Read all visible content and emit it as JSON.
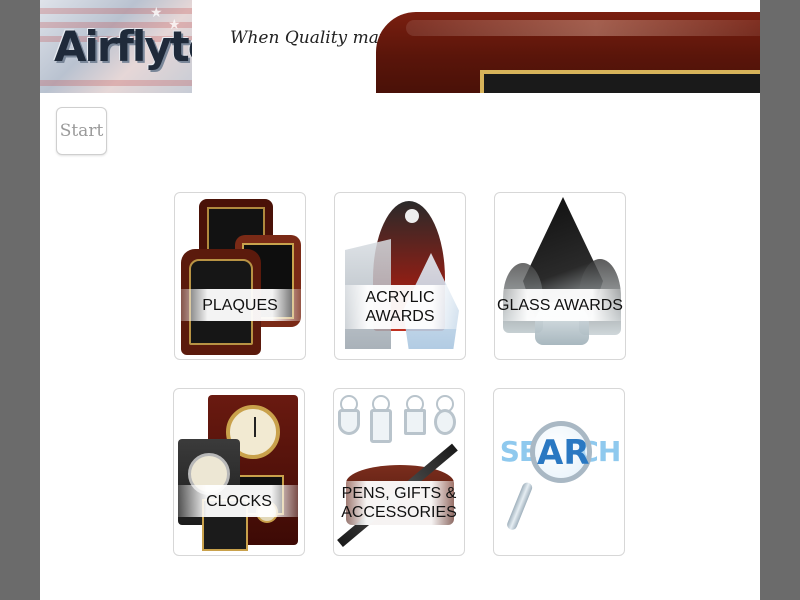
{
  "header": {
    "logo_text": "Airflyte",
    "tagline": "When Quality matters..."
  },
  "nav": {
    "start_label": "Start"
  },
  "categories": [
    {
      "label_line1": "PLAQUES",
      "label_line2": ""
    },
    {
      "label_line1": "ACRYLIC",
      "label_line2": "AWARDS"
    },
    {
      "label_line1": "GLASS AWARDS",
      "label_line2": ""
    },
    {
      "label_line1": "CLOCKS",
      "label_line2": ""
    },
    {
      "label_line1": "PENS, GIFTS &",
      "label_line2": "ACCESSORIES"
    },
    {
      "label_line1": "",
      "label_line2": ""
    }
  ],
  "search_tile": {
    "word_left": "SE",
    "word_mag": "AR",
    "word_right": "CH",
    "accent_color": "#2a78c2",
    "light_color": "#8fc9ee"
  },
  "colors": {
    "side_background": "#6b6b6b",
    "page_background": "#ffffff",
    "wood": "#5a150a",
    "gold": "#d7b35a"
  }
}
